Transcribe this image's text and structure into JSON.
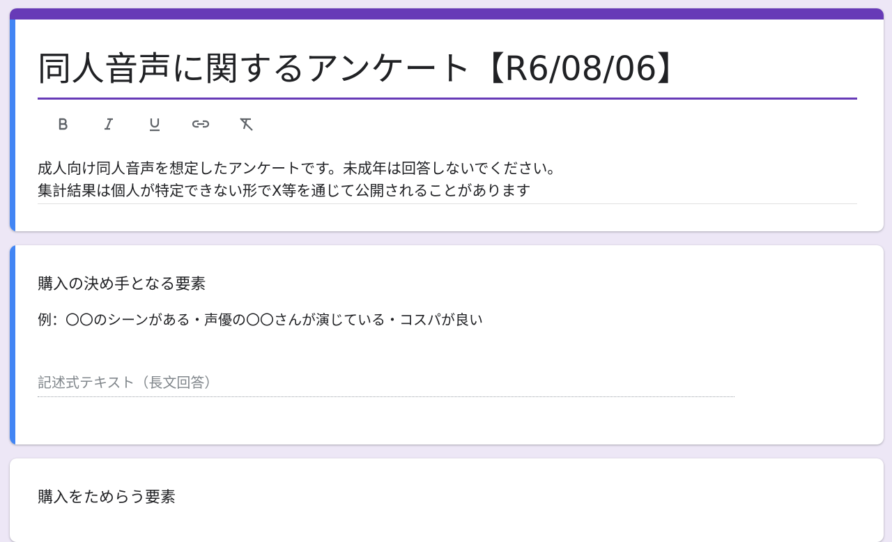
{
  "form": {
    "title": "同人音声に関するアンケート【R6/08/06】",
    "description_lines": [
      "成人向け同人音声を想定したアンケートです。未成年は回答しないでください。",
      "集計結果は個人が特定できない形でX等を通じて公開されることがあります"
    ],
    "toolbar": [
      "bold-icon",
      "italic-icon",
      "underline-icon",
      "link-icon",
      "clear-formatting-icon"
    ]
  },
  "questions": [
    {
      "title": "購入の決め手となる要素",
      "description": "例：〇〇のシーンがある・声優の〇〇さんが演じている・コスパが良い",
      "answer_placeholder": "記述式テキスト（長文回答）"
    },
    {
      "title": "購入をためらう要素"
    }
  ],
  "colors": {
    "theme": "#673ab7",
    "focus": "#4285f4",
    "background": "#ede7f6"
  }
}
